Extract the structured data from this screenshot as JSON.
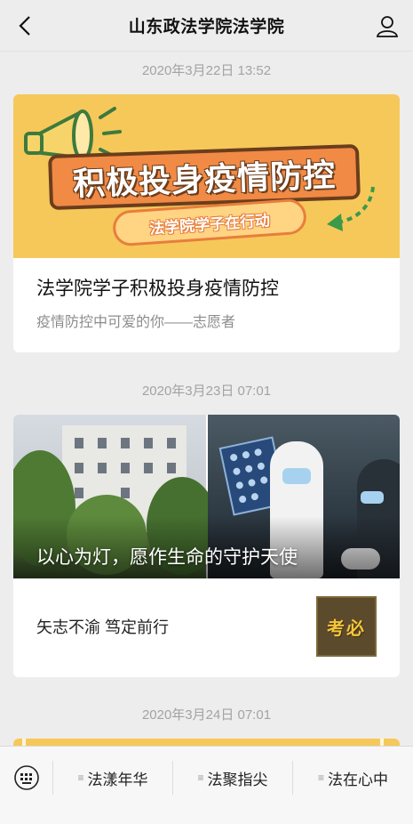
{
  "header": {
    "title": "山东政法学院法学院"
  },
  "feed": [
    {
      "timestamp": "2020年3月22日 13:52",
      "cover_banner": "积极投身疫情防控",
      "cover_pill": "法学院学子在行动",
      "headline": "法学院学子积极投身疫情防控",
      "subtitle": "疫情防控中可爱的你——志愿者"
    },
    {
      "timestamp": "2020年3月23日 07:01",
      "cover_title": "以心为灯，愿作生命的守护天使",
      "item_title": "矢志不渝  笃定前行",
      "thumb_text": "考必"
    },
    {
      "timestamp": "2020年3月24日 07:01"
    }
  ],
  "tabbar": {
    "menus": [
      "法漾年华",
      "法聚指尖",
      "法在心中"
    ]
  },
  "colors": {
    "background": "#ededed",
    "card": "#ffffff",
    "poster_yellow": "#f6c85a",
    "poster_orange": "#f08a45",
    "timestamp_gray": "#a3a3a3"
  }
}
